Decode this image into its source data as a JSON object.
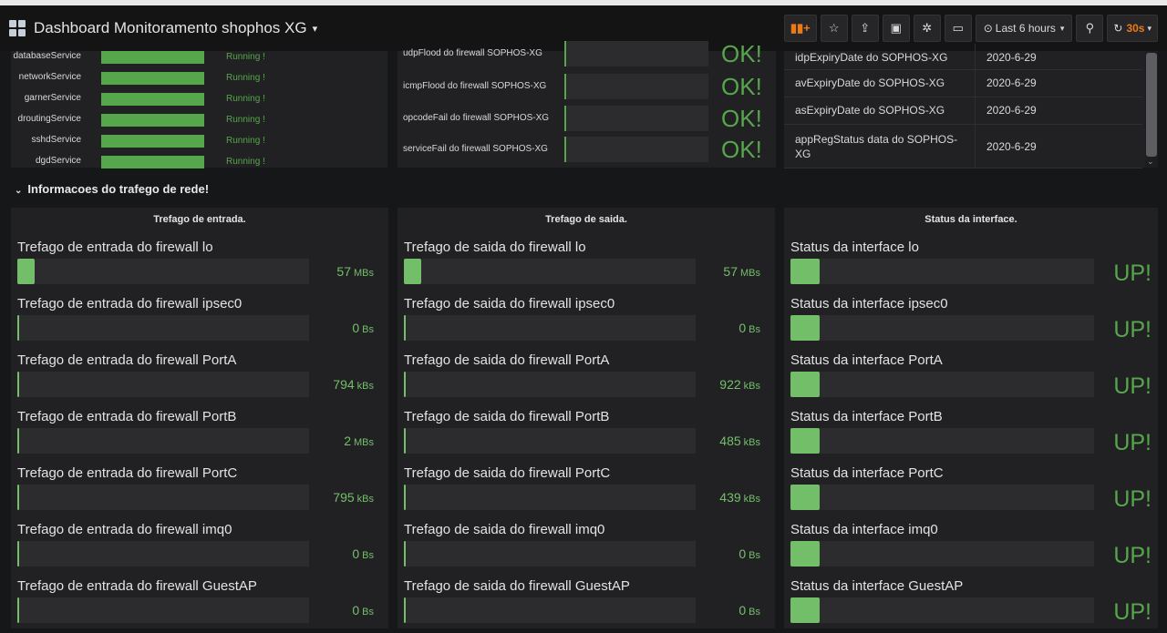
{
  "header": {
    "title": "Dashboard Monitoramento shophos XG",
    "time_range": "Last 6 hours",
    "refresh_interval": "30s"
  },
  "services": [
    {
      "name": "databaseService",
      "status": "Running !",
      "level": 1.0
    },
    {
      "name": "networkService",
      "status": "Running !",
      "level": 1.0
    },
    {
      "name": "garnerService",
      "status": "Running !",
      "level": 1.0
    },
    {
      "name": "droutingService",
      "status": "Running !",
      "level": 1.0
    },
    {
      "name": "sshdService",
      "status": "Running !",
      "level": 1.0
    },
    {
      "name": "dgdService",
      "status": "Running !",
      "level": 1.0
    }
  ],
  "checks": [
    {
      "label": "udpFlood do firewall SOPHOS-XG",
      "value": "OK!"
    },
    {
      "label": "icmpFlood do firewall SOPHOS-XG",
      "value": "OK!"
    },
    {
      "label": "opcodeFail do firewall SOPHOS-XG",
      "value": "OK!"
    },
    {
      "label": "serviceFail do firewall SOPHOS-XG",
      "value": "OK!"
    }
  ],
  "licenses": [
    {
      "key": "idpExpiryDate do SOPHOS-XG",
      "value": "2020-6-29"
    },
    {
      "key": "avExpiryDate do SOPHOS-XG",
      "value": "2020-6-29"
    },
    {
      "key": "asExpiryDate do SOPHOS-XG",
      "value": "2020-6-29"
    },
    {
      "key": "appRegStatus data do SOPHOS-XG",
      "value": "2020-6-29"
    }
  ],
  "row_title": "Informacoes do trafego de rede!",
  "inbound": {
    "title": "Trefago de entrada.",
    "items": [
      {
        "label": "Trefago de entrada do firewall lo",
        "value": "57",
        "unit": "MBs",
        "fraction": 0.06
      },
      {
        "label": "Trefago de entrada do firewall ipsec0",
        "value": "0",
        "unit": "Bs",
        "fraction": 0.0
      },
      {
        "label": "Trefago de entrada do firewall PortA",
        "value": "794",
        "unit": "kBs",
        "fraction": 0.0
      },
      {
        "label": "Trefago de entrada do firewall PortB",
        "value": "2",
        "unit": "MBs",
        "fraction": 0.0
      },
      {
        "label": "Trefago de entrada do firewall PortC",
        "value": "795",
        "unit": "kBs",
        "fraction": 0.0
      },
      {
        "label": "Trefago de entrada do firewall imq0",
        "value": "0",
        "unit": "Bs",
        "fraction": 0.0
      },
      {
        "label": "Trefago de entrada do firewall GuestAP",
        "value": "0",
        "unit": "Bs",
        "fraction": 0.0
      }
    ]
  },
  "outbound": {
    "title": "Trefago de saida.",
    "items": [
      {
        "label": "Trefago de saida do firewall lo",
        "value": "57",
        "unit": "MBs",
        "fraction": 0.06
      },
      {
        "label": "Trefago de saida do firewall ipsec0",
        "value": "0",
        "unit": "Bs",
        "fraction": 0.0
      },
      {
        "label": "Trefago de saida do firewall PortA",
        "value": "922",
        "unit": "kBs",
        "fraction": 0.0
      },
      {
        "label": "Trefago de saida do firewall PortB",
        "value": "485",
        "unit": "kBs",
        "fraction": 0.0
      },
      {
        "label": "Trefago de saida do firewall PortC",
        "value": "439",
        "unit": "kBs",
        "fraction": 0.0
      },
      {
        "label": "Trefago de saida do firewall imq0",
        "value": "0",
        "unit": "Bs",
        "fraction": 0.0
      },
      {
        "label": "Trefago de saida do firewall GuestAP",
        "value": "0",
        "unit": "Bs",
        "fraction": 0.0
      }
    ]
  },
  "interfaces": {
    "title": "Status da interface.",
    "items": [
      {
        "label": "Status da interface lo",
        "value": "UP!"
      },
      {
        "label": "Status da interface ipsec0",
        "value": "UP!"
      },
      {
        "label": "Status da interface PortA",
        "value": "UP!"
      },
      {
        "label": "Status da interface PortB",
        "value": "UP!"
      },
      {
        "label": "Status da interface PortC",
        "value": "UP!"
      },
      {
        "label": "Status da interface imq0",
        "value": "UP!"
      },
      {
        "label": "Status da interface GuestAP",
        "value": "UP!"
      }
    ]
  },
  "icons": {
    "add_panel": "add-panel-icon",
    "star": "star-icon",
    "share": "share-icon",
    "save": "save-icon",
    "settings": "gear-icon",
    "tv": "monitor-icon",
    "time": "clock-icon",
    "zoom": "zoom-out-icon",
    "refresh": "refresh-icon"
  },
  "colors": {
    "ok_green": "#56a64b",
    "bar_green": "#73bf69",
    "accent_orange": "#eb7b18",
    "panel_bg": "#212124",
    "page_bg": "#161719"
  }
}
